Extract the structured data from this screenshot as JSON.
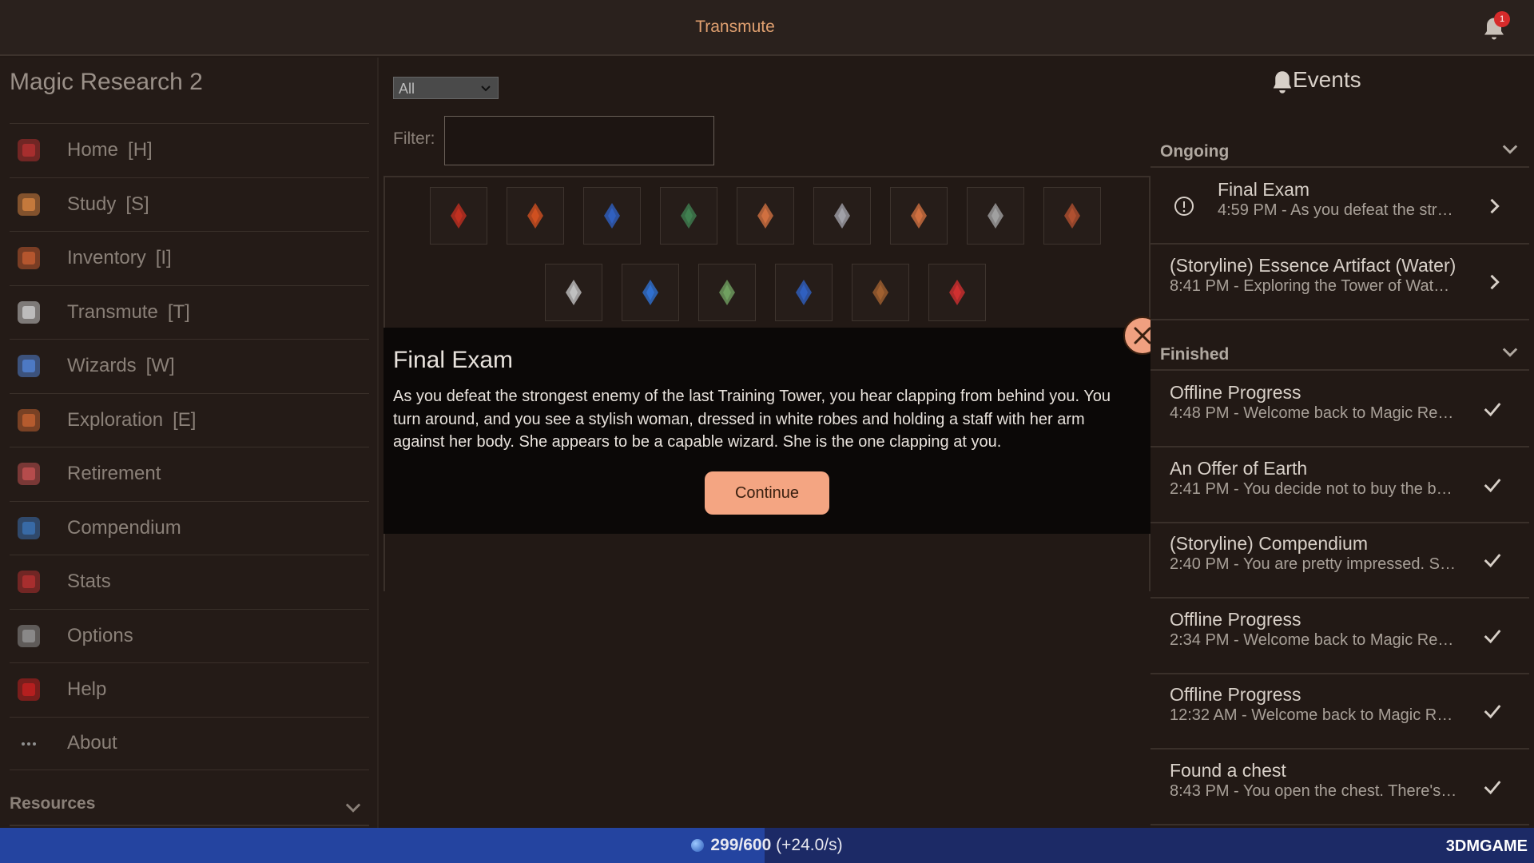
{
  "header": {
    "title": "Transmute",
    "notification_count": "1"
  },
  "sidebar": {
    "app_title": "Magic Research 2",
    "items": [
      {
        "label": "Home",
        "hotkey": "[H]",
        "icon": "house-icon",
        "color": "#b03030"
      },
      {
        "label": "Study",
        "hotkey": "[S]",
        "icon": "quill-icon",
        "color": "#d08040"
      },
      {
        "label": "Inventory",
        "hotkey": "[I]",
        "icon": "bag-icon",
        "color": "#c05a30"
      },
      {
        "label": "Transmute",
        "hotkey": "[T]",
        "icon": "sparkle-icon",
        "color": "#c8c8c8"
      },
      {
        "label": "Wizards",
        "hotkey": "[W]",
        "icon": "wand-icon",
        "color": "#5080d0"
      },
      {
        "label": "Exploration",
        "hotkey": "[E]",
        "icon": "map-icon",
        "color": "#c06030"
      },
      {
        "label": "Retirement",
        "hotkey": "",
        "icon": "chair-icon",
        "color": "#c05050"
      },
      {
        "label": "Compendium",
        "hotkey": "",
        "icon": "books-icon",
        "color": "#3a70b0"
      },
      {
        "label": "Stats",
        "hotkey": "",
        "icon": "scroll-icon",
        "color": "#b03030"
      },
      {
        "label": "Options",
        "hotkey": "",
        "icon": "gear-icon",
        "color": "#909090"
      },
      {
        "label": "Help",
        "hotkey": "",
        "icon": "question-icon",
        "color": "#c02020"
      },
      {
        "label": "About",
        "hotkey": "",
        "icon": "ellipsis-icon",
        "color": "#909090"
      }
    ],
    "resources_label": "Resources"
  },
  "center": {
    "select_value": "All",
    "filter_label": "Filter:",
    "filter_value": "",
    "items_row1": [
      {
        "icon": "fire-crystal-icon",
        "color": "#c03020"
      },
      {
        "icon": "ember-crystal-icon",
        "color": "#d05020"
      },
      {
        "icon": "water-crystal-icon",
        "color": "#3060c0"
      },
      {
        "icon": "nature-crystal-icon",
        "color": "#408050"
      },
      {
        "icon": "axe-icon",
        "color": "#d07040"
      },
      {
        "icon": "sword-icon",
        "color": "#a0a0a8"
      },
      {
        "icon": "staff-icon",
        "color": "#d07040"
      },
      {
        "icon": "charm-icon",
        "color": "#a0a0a0"
      },
      {
        "icon": "armor-icon",
        "color": "#b05030"
      }
    ],
    "items_row2": [
      {
        "icon": "shirt-icon",
        "color": "#c0c0c0"
      },
      {
        "icon": "robe-icon",
        "color": "#3070d0"
      },
      {
        "icon": "tunic-icon",
        "color": "#70a060"
      },
      {
        "icon": "gem-icon",
        "color": "#3060c0"
      },
      {
        "icon": "pouch-icon",
        "color": "#a06030"
      },
      {
        "icon": "potion-icon",
        "color": "#d03030"
      }
    ]
  },
  "modal": {
    "title": "Final Exam",
    "text": "As you defeat the strongest enemy of the last Training Tower, you hear clapping from behind you. You turn around, and you see a stylish woman, dressed in white robes and holding a staff with her arm against her body. She appears to be a capable wizard. She is the one clapping at you.",
    "continue_label": "Continue"
  },
  "events": {
    "title": "Events",
    "ongoing_label": "Ongoing",
    "finished_label": "Finished",
    "ongoing": [
      {
        "name": "Final Exam",
        "desc": "4:59 PM - As you defeat the str…"
      },
      {
        "name": "(Storyline) Essence Artifact (Water)",
        "desc": "8:41 PM - Exploring the Tower of Wat…"
      }
    ],
    "finished": [
      {
        "name": "Offline Progress",
        "desc": "4:48 PM - Welcome back to Magic Re…"
      },
      {
        "name": "An Offer of Earth",
        "desc": "2:41 PM - You decide not to buy the b…"
      },
      {
        "name": "(Storyline) Compendium",
        "desc": "2:40 PM - You are pretty impressed. S…"
      },
      {
        "name": "Offline Progress",
        "desc": "2:34 PM - Welcome back to Magic Re…"
      },
      {
        "name": "Offline Progress",
        "desc": "12:32 AM - Welcome back to Magic R…"
      },
      {
        "name": "Found a chest",
        "desc": "8:43 PM - You open the chest. There's…"
      }
    ]
  },
  "footer": {
    "mana_value": "299/600",
    "mana_rate": "(+24.0/s)",
    "mana_fraction": 0.4983,
    "watermark": "3DMGAME"
  },
  "colors": {
    "accent": "#e0a070",
    "button": "#f4a582",
    "background": "#221915",
    "mana_bar": "#2444a0"
  }
}
